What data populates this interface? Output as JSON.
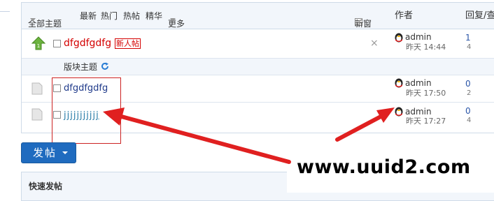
{
  "filters": {
    "all": "全部主题",
    "latest": "最新",
    "hot": "热门",
    "hotposts": "热帖",
    "digest": "精华",
    "more": "更多",
    "new_window": "新窗",
    "author_header": "作者",
    "reply_header": "回复/查"
  },
  "pinned": {
    "title": "dfgdfgdfg",
    "badge": "新人帖",
    "author": "admin",
    "time": "昨天 14:44",
    "replies": "1",
    "views": "4"
  },
  "section_label": "版块主题",
  "threads": [
    {
      "title": "dfgdfgdfg",
      "author": "admin",
      "time": "昨天 17:50",
      "replies": "0",
      "views": "2"
    },
    {
      "title": "jjjjjjjjjjj",
      "author": "admin",
      "time": "昨天 17:27",
      "replies": "0",
      "views": "4"
    }
  ],
  "post_button": "发帖",
  "quick_post": "快速发帖",
  "watermark": "www.uuid2.com",
  "colors": {
    "accent_red": "#d40000",
    "link_blue": "#1f3a8a",
    "button_blue": "#1f6bbf",
    "arrow_red": "#e02020"
  }
}
